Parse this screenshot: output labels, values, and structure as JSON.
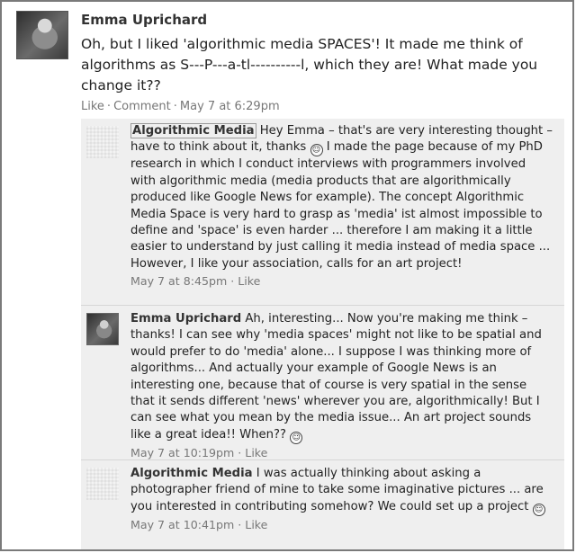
{
  "post": {
    "author": "Emma Uprichard",
    "text": "Oh, but I liked 'algorithmic media SPACES'! It made me think of algorithms as S---P---a-tl----------l, which they are! What made you change it??",
    "like": "Like",
    "comment": "Comment",
    "timestamp": "May 7 at 6:29pm",
    "separator": "·"
  },
  "comments": [
    {
      "author": "Algorithmic Media",
      "text_before": "Hey Emma – that's are very interesting thought – have to think about it, thanks",
      "text_after": "I made the page because of my PhD research in which I conduct interviews with programmers involved with algorithmic media (media products that are algorithmically produced like Google News for example). The concept Algorithmic Media Space is very hard to grasp as 'media' ist almost impossible to define and 'space' is even harder ... therefore I am making it a little easier to understand by just calling it media instead of media space ... However, I like your association, calls for an art project!",
      "timestamp": "May 7 at 8:45pm",
      "like": "Like"
    },
    {
      "author": "Emma Uprichard",
      "text_before": "Ah, interesting... Now you're making me think – thanks! I can see why 'media spaces' might not like to be spatial and would prefer to do 'media' alone... I suppose I was thinking more of algorithms... And actually your example of Google News is an interesting one, because that of course is very spatial in the sense that it sends different 'news' wherever you are, algorithmically! But I can see what you mean by the media issue... An art project sounds like a great idea!! When??",
      "timestamp": "May 7 at 10:19pm",
      "like": "Like"
    },
    {
      "author": "Algorithmic Media",
      "text_before": "I was actually thinking about asking a photographer friend of mine to take some imaginative pictures ... are you interested in contributing somehow? We could set up a project",
      "timestamp": "May 7 at 10:41pm",
      "like": "Like"
    }
  ],
  "icons": {
    "smiley": "smiley-icon"
  },
  "colors": {
    "comment_bg": "#efefef",
    "meta_text": "#777777",
    "border": "#7a7a7a"
  }
}
